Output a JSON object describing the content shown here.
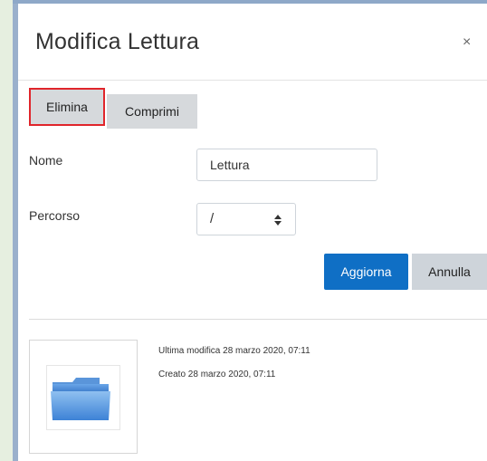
{
  "dialog": {
    "title": "Modifica Lettura",
    "close_label": "×"
  },
  "toolbar": {
    "delete_label": "Elimina",
    "compress_label": "Comprimi"
  },
  "form": {
    "name_label": "Nome",
    "name_value": "Lettura",
    "path_label": "Percorso",
    "path_value": "/"
  },
  "actions": {
    "update_label": "Aggiorna",
    "cancel_label": "Annulla"
  },
  "details": {
    "modified_text": "Ultima modifica  28 marzo 2020, 07:11",
    "created_text": "Creato  28 marzo 2020, 07:11"
  },
  "icons": {
    "thumbnail": "folder-icon",
    "select_arrows": "sort-arrows-icon"
  },
  "colors": {
    "primary_button": "#0f6fc5",
    "highlight_border": "#e0252b",
    "page_background": "#e9f0e2"
  }
}
